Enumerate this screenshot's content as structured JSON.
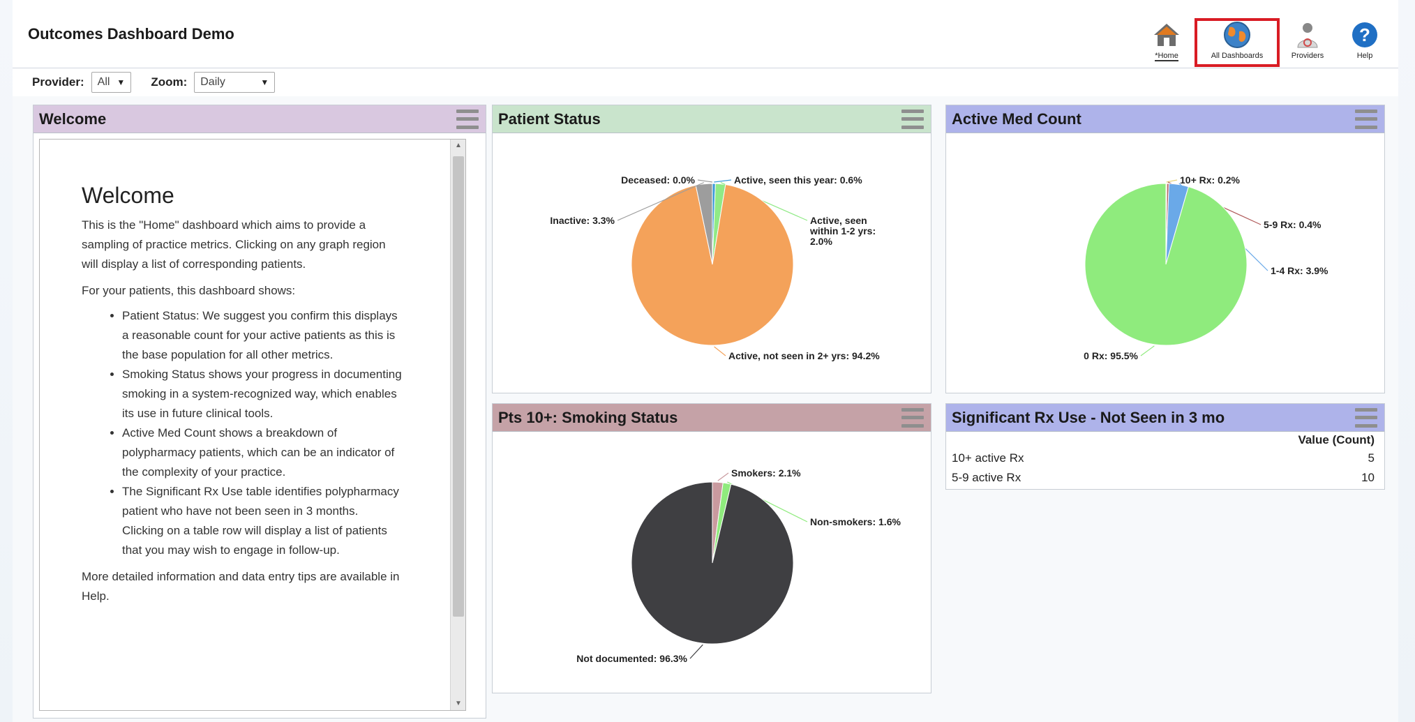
{
  "app": {
    "title": "Outcomes Dashboard Demo"
  },
  "nav": {
    "home_label": "*Home",
    "dashboards_label": "All Dashboards",
    "providers_label": "Providers",
    "help_label": "Help"
  },
  "filters": {
    "provider_label": "Provider:",
    "provider_value": "All",
    "zoom_label": "Zoom:",
    "zoom_value": "Daily"
  },
  "welcome": {
    "panel_title": "Welcome",
    "heading": "Welcome",
    "intro": "This is the \"Home\" dashboard which aims to provide a sampling of practice metrics. Clicking on any graph region will display a list of corresponding patients.",
    "list_intro": "For your patients, this dashboard shows:",
    "bullets": [
      "Patient Status: We suggest you confirm this displays a reasonable count for your active patients as this is the base population for all other metrics.",
      "Smoking Status shows your progress in documenting smoking in a system-recognized way, which enables its use in future clinical tools.",
      "Active Med Count shows a breakdown of polypharmacy patients, which can be an indicator of the complexity of your practice.",
      "The Significant Rx Use table identifies polypharmacy patient who have not been seen in 3 months. Clicking on a table row will display a list of patients that you may wish to engage in follow-up."
    ],
    "outro": "More detailed information and data entry tips are available in Help."
  },
  "panels": {
    "patient_status_title": "Patient Status",
    "active_med_title": "Active Med Count",
    "smoking_title": "Pts 10+: Smoking Status",
    "rx_table_title": "Significant Rx Use - Not Seen in 3 mo"
  },
  "rx_table": {
    "value_header": "Value (Count)",
    "rows": [
      {
        "label": "10+ active Rx",
        "value": "5"
      },
      {
        "label": "5-9 active Rx",
        "value": "10"
      }
    ]
  },
  "colors": {
    "welcome_header": "#d9c8e0",
    "patient_header": "#c9e4cc",
    "med_header": "#aeb3ea",
    "smoking_header": "#c5a2a7",
    "rx_header": "#aeb3ea",
    "highlight": "#d91c24"
  },
  "chart_data": [
    {
      "type": "pie",
      "title": "Patient Status",
      "slices": [
        {
          "label": "Active, seen this year: 0.6%",
          "value": 0.6,
          "color": "#3b9ad8"
        },
        {
          "label": "Active, seen within 1-2 yrs: 2.0%",
          "value": 2.0,
          "color": "#90ea86"
        },
        {
          "label": "Active, not seen in 2+ yrs: 94.2%",
          "value": 94.2,
          "color": "#f4a25a"
        },
        {
          "label": "Inactive: 3.3%",
          "value": 3.3,
          "color": "#9d9d9d"
        },
        {
          "label": "Deceased: 0.0%",
          "value": 0.0,
          "color": "#e8b0b8"
        }
      ]
    },
    {
      "type": "pie",
      "title": "Active Med Count",
      "slices": [
        {
          "label": "10+ Rx: 0.2%",
          "value": 0.2,
          "color": "#e6d27a"
        },
        {
          "label": "5-9 Rx: 0.4%",
          "value": 0.4,
          "color": "#b05b5b"
        },
        {
          "label": "1-4 Rx: 3.9%",
          "value": 3.9,
          "color": "#6aa9e8"
        },
        {
          "label": "0 Rx: 95.5%",
          "value": 95.5,
          "color": "#8feb7d"
        }
      ]
    },
    {
      "type": "pie",
      "title": "Pts 10+: Smoking Status",
      "slices": [
        {
          "label": "Smokers: 2.1%",
          "value": 2.1,
          "color": "#c99a9f"
        },
        {
          "label": "Non-smokers: 1.6%",
          "value": 1.6,
          "color": "#8feb7d"
        },
        {
          "label": "Not documented: 96.3%",
          "value": 96.3,
          "color": "#3f3f42"
        }
      ]
    }
  ]
}
